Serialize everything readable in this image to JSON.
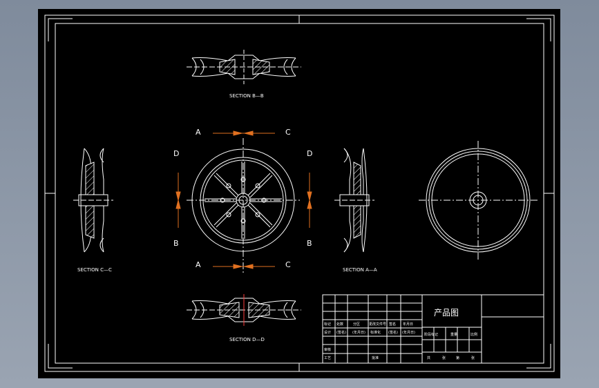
{
  "drawing": {
    "section_bb": "SECTION B—B",
    "section_dd": "SECTION D—D",
    "section_cc": "SECTION C—C",
    "section_aa": "SECTION A—A",
    "cut_letters": {
      "top_left": "A",
      "top_right": "C",
      "bottom_left": "A",
      "bottom_right": "C",
      "left_top": "D",
      "left_bottom": "B",
      "right_top": "D",
      "right_bottom": "B"
    }
  },
  "title_block": {
    "title": "产品图",
    "row_labels": [
      "标记",
      "处数",
      "分区",
      "更改文件号",
      "签名",
      "年月日"
    ],
    "row2": [
      "设计",
      "(签名)",
      "(年月日)",
      "标准化",
      "(签名)",
      "(年月日)"
    ],
    "row3": [
      "审核",
      "工艺",
      "批准"
    ],
    "stage_labels": [
      "阶段标记",
      "重量",
      "比例"
    ],
    "sheet_labels": [
      "共",
      "张",
      "第",
      "张"
    ]
  },
  "colors": {
    "background": "#000000",
    "frame": "#ffffff",
    "arrow": "#e07020",
    "accent_line": "#ff3b3b",
    "viewport": "#8c97a7"
  }
}
